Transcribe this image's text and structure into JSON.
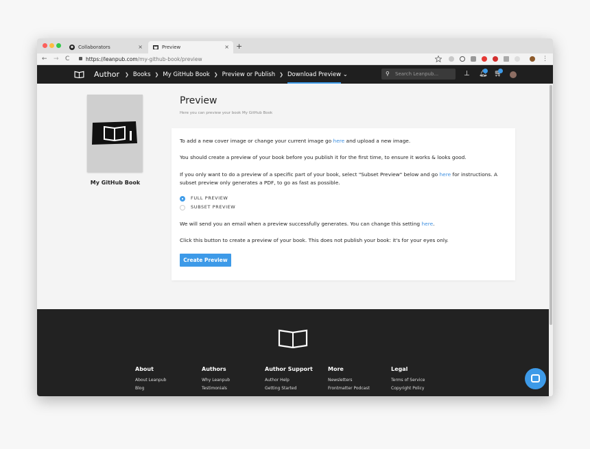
{
  "browser": {
    "tabs": [
      {
        "label": "Collaborators",
        "icon": "github-icon",
        "active": false
      },
      {
        "label": "Preview",
        "icon": "leanpub-book-icon",
        "active": true
      }
    ],
    "close_glyph": "×",
    "new_tab_glyph": "+",
    "nav": {
      "back": "←",
      "forward": "→",
      "reload": "C"
    },
    "url_host": "https://leanpub.com",
    "url_path": "/my-github-book/preview"
  },
  "header": {
    "author_label": "Author",
    "crumbs": [
      "Books",
      "My GitHub Book",
      "Preview or Publish",
      "Download Preview"
    ],
    "search_placeholder": "Search Leanpub...",
    "notification_count": "4",
    "cart_count": "2"
  },
  "sidebar": {
    "book_title": "My GitHub Book"
  },
  "main": {
    "title": "Preview",
    "subtitle": "Here you can preview your book My GitHub Book",
    "p1_before": "To add a new cover image or change your current image go ",
    "p1_link": "here",
    "p1_after": " and upload a new image.",
    "p2": "You should create a preview of your book before you publish it for the first time, to ensure it works & looks good.",
    "p3_before": "If you only want to do a preview of a specific part of your book, select \"Subset Preview\" below and go ",
    "p3_link": "here",
    "p3_after": " for instructions. A subset preview only generates a PDF, to go as fast as possible.",
    "options": [
      {
        "label": "FULL PREVIEW",
        "selected": true
      },
      {
        "label": "SUBSET PREVIEW",
        "selected": false
      }
    ],
    "p4_before": "We will send you an email when a preview successfully generates. You can change this setting ",
    "p4_link": "here",
    "p4_after": ".",
    "p5": "Click this button to create a preview of your book. This does not publish your book: it's for your eyes only.",
    "button_label": "Create Preview"
  },
  "footer": {
    "columns": [
      {
        "heading": "About",
        "links": [
          "About Leanpub",
          "Blog"
        ]
      },
      {
        "heading": "Authors",
        "links": [
          "Why Leanpub",
          "Testimonials"
        ]
      },
      {
        "heading": "Author Support",
        "links": [
          "Author Help",
          "Getting Started"
        ]
      },
      {
        "heading": "More",
        "links": [
          "Newsletters",
          "Frontmatter Podcast"
        ]
      },
      {
        "heading": "Legal",
        "links": [
          "Terms of Service",
          "Copyright Policy"
        ]
      }
    ]
  },
  "colors": {
    "accent": "#3d9ae8",
    "header_bg": "#1f1f1f",
    "footer_bg": "#222222"
  }
}
